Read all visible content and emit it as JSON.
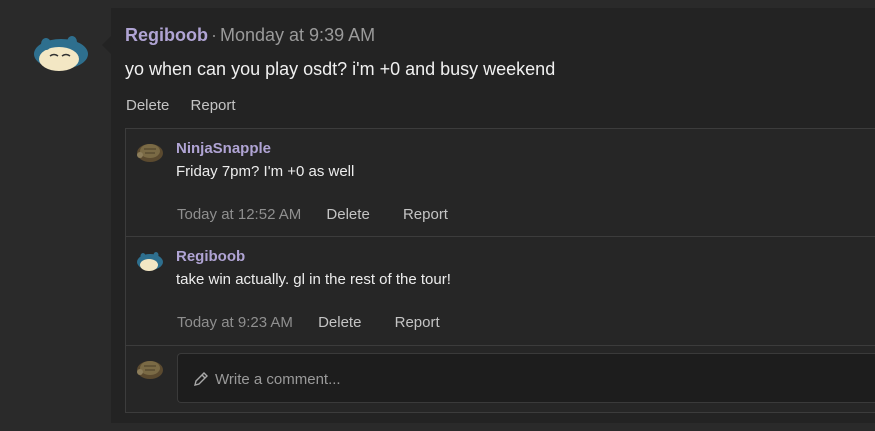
{
  "post": {
    "author": "Regiboob",
    "separator": "·",
    "timestamp": "Monday at 9:39 AM",
    "body": "yo when can you play osdt? i'm +0 and busy weekend",
    "actions": {
      "delete": "Delete",
      "report": "Report"
    }
  },
  "comments": [
    {
      "author": "NinjaSnapple",
      "text": "Friday 7pm? I'm +0 as well",
      "time": "Today at 12:52 AM",
      "delete": "Delete",
      "report": "Report"
    },
    {
      "author": "Regiboob",
      "text": "take win actually. gl in the rest of the tour!",
      "time": "Today at 9:23 AM",
      "delete": "Delete",
      "report": "Report"
    }
  ],
  "comment_input": {
    "placeholder": "Write a comment..."
  },
  "colors": {
    "author": "#b0a4d4",
    "panel": "#232323",
    "background": "#2a2a2a"
  },
  "icons": {
    "main_avatar": "snorlax-avatar",
    "comment_avatar": "turtle-avatar",
    "input": "pencil-icon"
  }
}
